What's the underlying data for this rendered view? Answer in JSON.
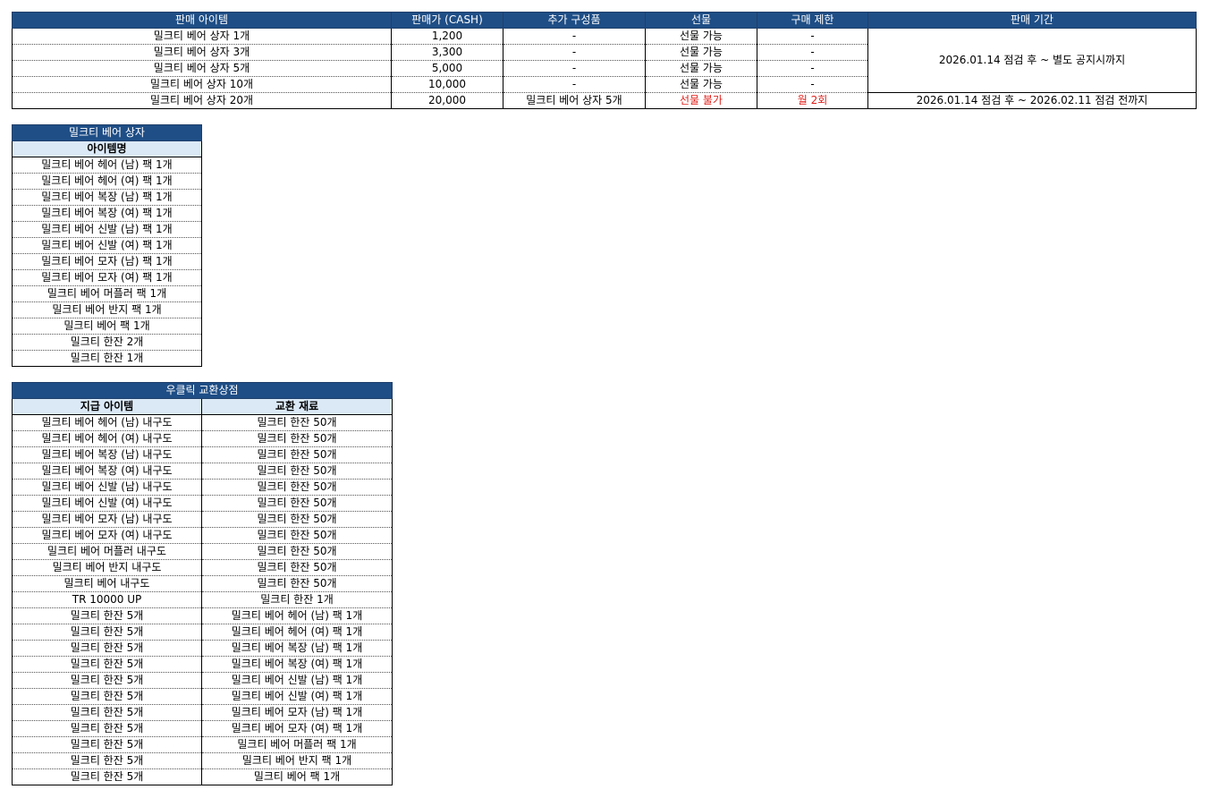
{
  "sales": {
    "headers": [
      "판매 아이템",
      "판매가 (CASH)",
      "추가 구성품",
      "선물",
      "구매 제한",
      "판매 기간"
    ],
    "rows": [
      {
        "item": "밀크티 베어 상자 1개",
        "price": "1,200",
        "extra": "-",
        "gift": "선물 가능",
        "limit": "-"
      },
      {
        "item": "밀크티 베어 상자 3개",
        "price": "3,300",
        "extra": "-",
        "gift": "선물 가능",
        "limit": "-"
      },
      {
        "item": "밀크티 베어 상자 5개",
        "price": "5,000",
        "extra": "-",
        "gift": "선물 가능",
        "limit": "-"
      },
      {
        "item": "밀크티 베어 상자 10개",
        "price": "10,000",
        "extra": "-",
        "gift": "선물 가능",
        "limit": "-"
      },
      {
        "item": "밀크티 베어 상자 20개",
        "price": "20,000",
        "extra": "밀크티 베어 상자 5개",
        "gift": "선물 불가",
        "limit": "월 2회"
      }
    ],
    "period_a": "2026.01.14 점검 후 ~ 별도 공지시까지",
    "period_b": "2026.01.14 점검 후 ~ 2026.02.11 점검 전까지",
    "highlight_color": "#e0201b"
  },
  "box": {
    "title": "밀크티 베어 상자",
    "column": "아이템명",
    "items": [
      "밀크티 베어 헤어 (남) 팩 1개",
      "밀크티 베어 헤어 (여) 팩 1개",
      "밀크티 베어 복장 (남) 팩 1개",
      "밀크티 베어 복장 (여) 팩 1개",
      "밀크티 베어 신발 (남) 팩 1개",
      "밀크티 베어 신발 (여) 팩 1개",
      "밀크티 베어 모자 (남) 팩 1개",
      "밀크티 베어 모자 (여) 팩 1개",
      "밀크티 베어 머플러 팩 1개",
      "밀크티 베어 반지 팩 1개",
      "밀크티 베어 팩 1개",
      "밀크티 한잔 2개",
      "밀크티 한잔 1개"
    ]
  },
  "exchange": {
    "title": "우클릭 교환상점",
    "headers": [
      "지급 아이템",
      "교환 재료"
    ],
    "rows": [
      [
        "밀크티 베어 헤어 (남) 내구도",
        "밀크티 한잔 50개"
      ],
      [
        "밀크티 베어 헤어 (여) 내구도",
        "밀크티 한잔 50개"
      ],
      [
        "밀크티 베어 복장 (남) 내구도",
        "밀크티 한잔 50개"
      ],
      [
        "밀크티 베어 복장 (여) 내구도",
        "밀크티 한잔 50개"
      ],
      [
        "밀크티 베어 신발 (남) 내구도",
        "밀크티 한잔 50개"
      ],
      [
        "밀크티 베어 신발 (여) 내구도",
        "밀크티 한잔 50개"
      ],
      [
        "밀크티 베어 모자 (남) 내구도",
        "밀크티 한잔 50개"
      ],
      [
        "밀크티 베어 모자 (여) 내구도",
        "밀크티 한잔 50개"
      ],
      [
        "밀크티 베어 머플러 내구도",
        "밀크티 한잔 50개"
      ],
      [
        "밀크티 베어 반지 내구도",
        "밀크티 한잔 50개"
      ],
      [
        "밀크티 베어 내구도",
        "밀크티 한잔 50개"
      ],
      [
        "TR 10000 UP",
        "밀크티 한잔 1개"
      ],
      [
        "밀크티 한잔 5개",
        "밀크티 베어 헤어 (남) 팩 1개"
      ],
      [
        "밀크티 한잔 5개",
        "밀크티 베어 헤어 (여) 팩 1개"
      ],
      [
        "밀크티 한잔 5개",
        "밀크티 베어 복장 (남) 팩 1개"
      ],
      [
        "밀크티 한잔 5개",
        "밀크티 베어 복장 (여) 팩 1개"
      ],
      [
        "밀크티 한잔 5개",
        "밀크티 베어 신발 (남) 팩 1개"
      ],
      [
        "밀크티 한잔 5개",
        "밀크티 베어 신발 (여) 팩 1개"
      ],
      [
        "밀크티 한잔 5개",
        "밀크티 베어 모자 (남) 팩 1개"
      ],
      [
        "밀크티 한잔 5개",
        "밀크티 베어 모자 (여) 팩 1개"
      ],
      [
        "밀크티 한잔 5개",
        "밀크티 베어 머플러 팩 1개"
      ],
      [
        "밀크티 한잔 5개",
        "밀크티 베어 반지 팩 1개"
      ],
      [
        "밀크티 한잔 5개",
        "밀크티 베어 팩 1개"
      ]
    ]
  }
}
